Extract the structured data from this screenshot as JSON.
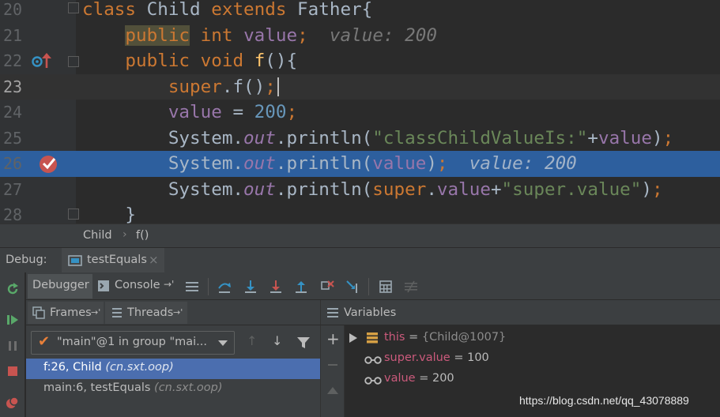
{
  "editor": {
    "lines": [
      {
        "num": "20"
      },
      {
        "num": "21",
        "inline": "value: 200"
      },
      {
        "num": "22"
      },
      {
        "num": "23"
      },
      {
        "num": "24"
      },
      {
        "num": "25"
      },
      {
        "num": "26",
        "inline": "value: 200"
      },
      {
        "num": "27"
      },
      {
        "num": "28"
      }
    ]
  },
  "breadcrumb": {
    "class": "Child",
    "method": "f()"
  },
  "debug": {
    "label": "Debug:",
    "session_tab": "testEquals",
    "toolbar": {
      "debugger_tab": "Debugger",
      "console_tab": "Console"
    },
    "frames_tab": "Frames",
    "threads_tab": "Threads",
    "variables_title": "Variables",
    "thread_select": "\"main\"@1 in group \"mai...",
    "frames": [
      {
        "name": "f:26, Child ",
        "pkg": "(cn.sxt.oop)"
      },
      {
        "name": "main:6, testEquals ",
        "pkg": "(cn.sxt.oop)"
      }
    ],
    "variables": [
      {
        "name": "this",
        "eq": " = ",
        "value": "{Child@1007}"
      },
      {
        "name": "super.value",
        "eq": " = ",
        "value": "100"
      },
      {
        "name": "value",
        "eq": " = ",
        "value": "200"
      }
    ]
  },
  "watermark": "https://blog.csdn.net/qq_43078889",
  "colors": {
    "keyword": "#cc7832",
    "field": "#9876aa",
    "number": "#6897bb",
    "string": "#6a8759",
    "selection": "#2d5f9e",
    "frame_selection": "#4b6eaf"
  }
}
